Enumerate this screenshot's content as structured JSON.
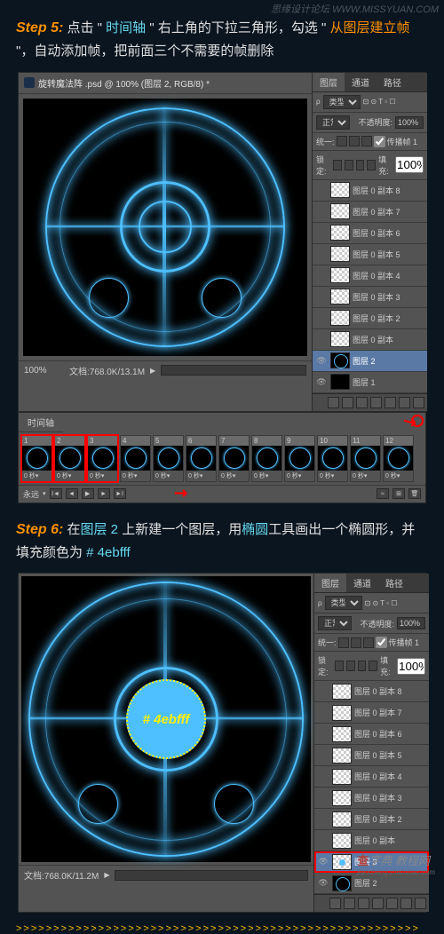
{
  "header_watermark": "思缘设计论坛  WWW.MISSYUAN.COM",
  "step5": {
    "label": "Step 5:",
    "text_1": " 点击 \"",
    "hl_1": " 时间轴 ",
    "text_2": "\" 右上角的下拉三角形，勾选 \"",
    "hl_2": " 从图层建立帧 ",
    "text_3": "\"，自动添加帧，把前面三个不需要的帧删除",
    "titlebar": "旋转魔法阵 .psd @ 100% (图层 2, RGB/8) *",
    "zoom": "100%",
    "status": "文档:768.0K/13.1M"
  },
  "layers_panel": {
    "tabs": [
      "图层",
      "通道",
      "路径"
    ],
    "type_label": "类型",
    "blend_mode": "正常",
    "opacity_label": "不透明度:",
    "opacity_value": "100%",
    "unify_label": "统一:",
    "propagate_label": "传播帧 1",
    "lock_label": "锁定:",
    "fill_label": "填充:",
    "fill_value": "100%"
  },
  "layers_s5": [
    {
      "name": "图层 0 副本 8",
      "thumb": "trans",
      "visible": false
    },
    {
      "name": "图层 0 副本 7",
      "thumb": "trans",
      "visible": false
    },
    {
      "name": "图层 0 副本 6",
      "thumb": "trans",
      "visible": false
    },
    {
      "name": "图层 0 副本 5",
      "thumb": "trans",
      "visible": false
    },
    {
      "name": "图层 0 副本 4",
      "thumb": "trans",
      "visible": false
    },
    {
      "name": "图层 0 副本 3",
      "thumb": "trans",
      "visible": false
    },
    {
      "name": "图层 0 副本 2",
      "thumb": "trans",
      "visible": false
    },
    {
      "name": "图层 0 副本",
      "thumb": "trans",
      "visible": false
    },
    {
      "name": "图层 2",
      "thumb": "dark",
      "visible": true,
      "selected": true
    },
    {
      "name": "图层 1",
      "thumb": "black",
      "visible": true
    }
  ],
  "timeline": {
    "tab": "时间轴",
    "loop": "永远",
    "frames": [
      {
        "n": "1",
        "t": "0 秒▾",
        "hl": true
      },
      {
        "n": "2",
        "t": "0 秒▾",
        "hl": true
      },
      {
        "n": "3",
        "t": "0 秒▾",
        "hl": true
      },
      {
        "n": "4",
        "t": "0 秒▾"
      },
      {
        "n": "5",
        "t": "0 秒▾"
      },
      {
        "n": "6",
        "t": "0 秒▾"
      },
      {
        "n": "7",
        "t": "0 秒▾"
      },
      {
        "n": "8",
        "t": "0 秒▾"
      },
      {
        "n": "9",
        "t": "0 秒▾"
      },
      {
        "n": "10",
        "t": "0 秒▾"
      },
      {
        "n": "11",
        "t": "0 秒▾"
      },
      {
        "n": "12",
        "t": "0 秒▾"
      }
    ]
  },
  "step6": {
    "label": "Step 6:",
    "text_1": " 在",
    "hl_1": "图层 2 ",
    "text_2": "上新建一个图层，用",
    "hl_2": "椭圆",
    "text_3": "工具画出一个椭圆形，并填充颜色为 ",
    "hl_3": "# 4ebfff",
    "color_text": "# 4ebfff",
    "status": "文档:768.0K/11.2M"
  },
  "layers_s6": [
    {
      "name": "图层 0 副本 8",
      "thumb": "trans",
      "visible": false
    },
    {
      "name": "图层 0 副本 7",
      "thumb": "trans",
      "visible": false
    },
    {
      "name": "图层 0 副本 6",
      "thumb": "trans",
      "visible": false
    },
    {
      "name": "图层 0 副本 5",
      "thumb": "trans",
      "visible": false
    },
    {
      "name": "图层 0 副本 4",
      "thumb": "trans",
      "visible": false
    },
    {
      "name": "图层 0 副本 3",
      "thumb": "trans",
      "visible": false
    },
    {
      "name": "图层 0 副本 2",
      "thumb": "trans",
      "visible": false
    },
    {
      "name": "图层 0 副本",
      "thumb": "trans",
      "visible": false
    },
    {
      "name": "图层 3",
      "thumb": "blue-dot",
      "visible": true,
      "selected": true,
      "hl_red": true
    },
    {
      "name": "图层 2",
      "thumb": "dark",
      "visible": true
    }
  ],
  "divider": ">>>>>>>>>>>>>>>>>>>>>>>>>>>>>>>>>>>>>>>>>>>>>>>>>>>>>>",
  "footer": {
    "brand_hl": "查",
    "brand_rest": "字典 教程网",
    "url": "jiaocheng.chazidian.com"
  }
}
